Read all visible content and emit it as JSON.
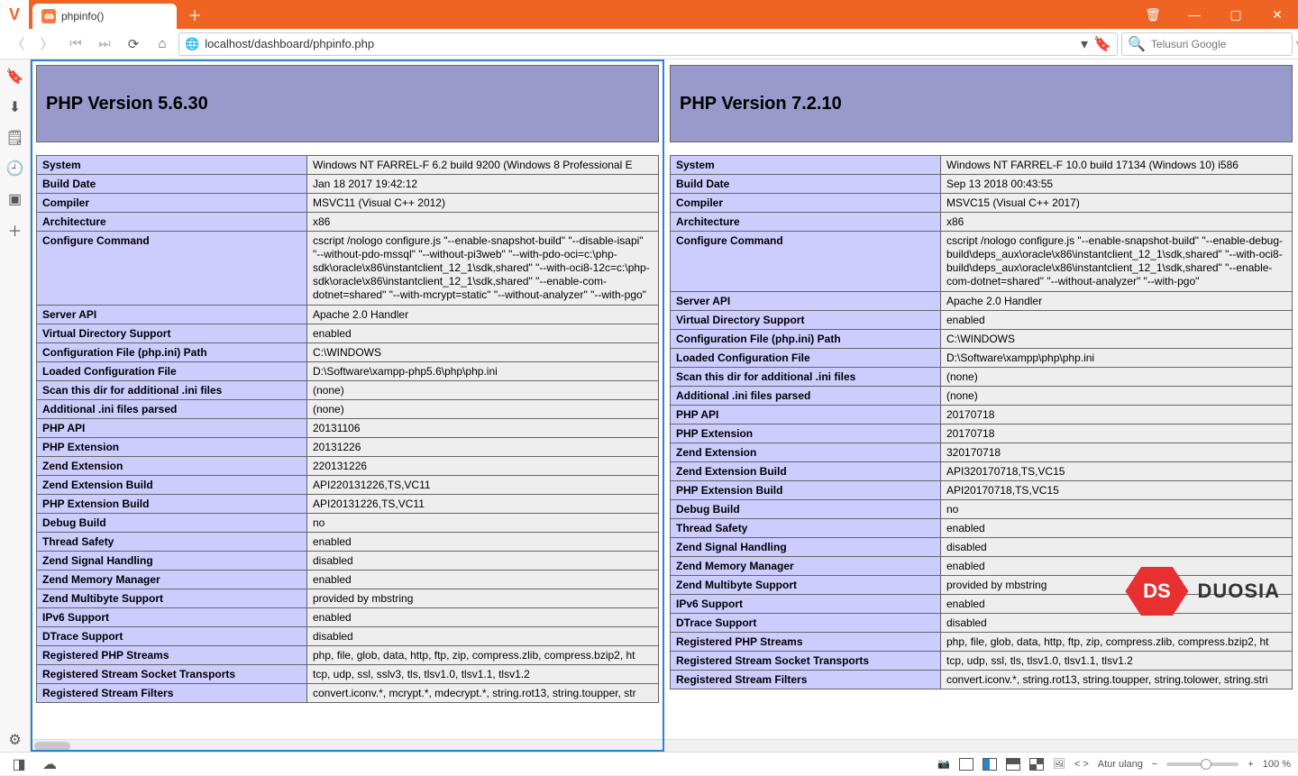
{
  "tab": {
    "title": "phpinfo()"
  },
  "addressbar": {
    "url": "localhost/dashboard/phpinfo.php",
    "search_placeholder": "Telusuri Google"
  },
  "footer": {
    "reset_label": "Atur ulang",
    "zoom": "100 %"
  },
  "watermark": {
    "badge": "DS",
    "text": "DUOSIA"
  },
  "left": {
    "title": "PHP Version 5.6.30",
    "rows": [
      {
        "k": "System",
        "v": "Windows NT FARREL-F 6.2 build 9200 (Windows 8 Professional E"
      },
      {
        "k": "Build Date",
        "v": "Jan 18 2017 19:42:12"
      },
      {
        "k": "Compiler",
        "v": "MSVC11 (Visual C++ 2012)"
      },
      {
        "k": "Architecture",
        "v": "x86"
      },
      {
        "k": "Configure Command",
        "v": "cscript /nologo configure.js \"--enable-snapshot-build\" \"--disable-isapi\" \"--without-pdo-mssql\" \"--without-pi3web\" \"--with-pdo-oci=c:\\php-sdk\\oracle\\x86\\instantclient_12_1\\sdk,shared\" \"--with-oci8-12c=c:\\php-sdk\\oracle\\x86\\instantclient_12_1\\sdk,shared\" \"--enable-com-dotnet=shared\" \"--with-mcrypt=static\" \"--without-analyzer\" \"--with-pgo\""
      },
      {
        "k": "Server API",
        "v": "Apache 2.0 Handler"
      },
      {
        "k": "Virtual Directory Support",
        "v": "enabled"
      },
      {
        "k": "Configuration File (php.ini) Path",
        "v": "C:\\WINDOWS"
      },
      {
        "k": "Loaded Configuration File",
        "v": "D:\\Software\\xampp-php5.6\\php\\php.ini"
      },
      {
        "k": "Scan this dir for additional .ini files",
        "v": "(none)"
      },
      {
        "k": "Additional .ini files parsed",
        "v": "(none)"
      },
      {
        "k": "PHP API",
        "v": "20131106"
      },
      {
        "k": "PHP Extension",
        "v": "20131226"
      },
      {
        "k": "Zend Extension",
        "v": "220131226"
      },
      {
        "k": "Zend Extension Build",
        "v": "API220131226,TS,VC11"
      },
      {
        "k": "PHP Extension Build",
        "v": "API20131226,TS,VC11"
      },
      {
        "k": "Debug Build",
        "v": "no"
      },
      {
        "k": "Thread Safety",
        "v": "enabled"
      },
      {
        "k": "Zend Signal Handling",
        "v": "disabled"
      },
      {
        "k": "Zend Memory Manager",
        "v": "enabled"
      },
      {
        "k": "Zend Multibyte Support",
        "v": "provided by mbstring"
      },
      {
        "k": "IPv6 Support",
        "v": "enabled"
      },
      {
        "k": "DTrace Support",
        "v": "disabled"
      },
      {
        "k": "Registered PHP Streams",
        "v": "php, file, glob, data, http, ftp, zip, compress.zlib, compress.bzip2, ht"
      },
      {
        "k": "Registered Stream Socket Transports",
        "v": "tcp, udp, ssl, sslv3, tls, tlsv1.0, tlsv1.1, tlsv1.2"
      },
      {
        "k": "Registered Stream Filters",
        "v": "convert.iconv.*, mcrypt.*, mdecrypt.*, string.rot13, string.toupper, str"
      }
    ]
  },
  "right": {
    "title": "PHP Version 7.2.10",
    "rows": [
      {
        "k": "System",
        "v": "Windows NT FARREL-F 10.0 build 17134 (Windows 10) i586"
      },
      {
        "k": "Build Date",
        "v": "Sep 13 2018 00:43:55"
      },
      {
        "k": "Compiler",
        "v": "MSVC15 (Visual C++ 2017)"
      },
      {
        "k": "Architecture",
        "v": "x86"
      },
      {
        "k": "Configure Command",
        "v": "cscript /nologo configure.js \"--enable-snapshot-build\" \"--enable-debug-build\\deps_aux\\oracle\\x86\\instantclient_12_1\\sdk,shared\" \"--with-oci8-build\\deps_aux\\oracle\\x86\\instantclient_12_1\\sdk,shared\" \"--enable-com-dotnet=shared\" \"--without-analyzer\" \"--with-pgo\""
      },
      {
        "k": "Server API",
        "v": "Apache 2.0 Handler"
      },
      {
        "k": "Virtual Directory Support",
        "v": "enabled"
      },
      {
        "k": "Configuration File (php.ini) Path",
        "v": "C:\\WINDOWS"
      },
      {
        "k": "Loaded Configuration File",
        "v": "D:\\Software\\xampp\\php\\php.ini"
      },
      {
        "k": "Scan this dir for additional .ini files",
        "v": "(none)"
      },
      {
        "k": "Additional .ini files parsed",
        "v": "(none)"
      },
      {
        "k": "PHP API",
        "v": "20170718"
      },
      {
        "k": "PHP Extension",
        "v": "20170718"
      },
      {
        "k": "Zend Extension",
        "v": "320170718"
      },
      {
        "k": "Zend Extension Build",
        "v": "API320170718,TS,VC15"
      },
      {
        "k": "PHP Extension Build",
        "v": "API20170718,TS,VC15"
      },
      {
        "k": "Debug Build",
        "v": "no"
      },
      {
        "k": "Thread Safety",
        "v": "enabled"
      },
      {
        "k": "Zend Signal Handling",
        "v": "disabled"
      },
      {
        "k": "Zend Memory Manager",
        "v": "enabled"
      },
      {
        "k": "Zend Multibyte Support",
        "v": "provided by mbstring"
      },
      {
        "k": "IPv6 Support",
        "v": "enabled"
      },
      {
        "k": "DTrace Support",
        "v": "disabled"
      },
      {
        "k": "Registered PHP Streams",
        "v": "php, file, glob, data, http, ftp, zip, compress.zlib, compress.bzip2, ht"
      },
      {
        "k": "Registered Stream Socket Transports",
        "v": "tcp, udp, ssl, tls, tlsv1.0, tlsv1.1, tlsv1.2"
      },
      {
        "k": "Registered Stream Filters",
        "v": "convert.iconv.*, string.rot13, string.toupper, string.tolower, string.stri"
      }
    ]
  }
}
